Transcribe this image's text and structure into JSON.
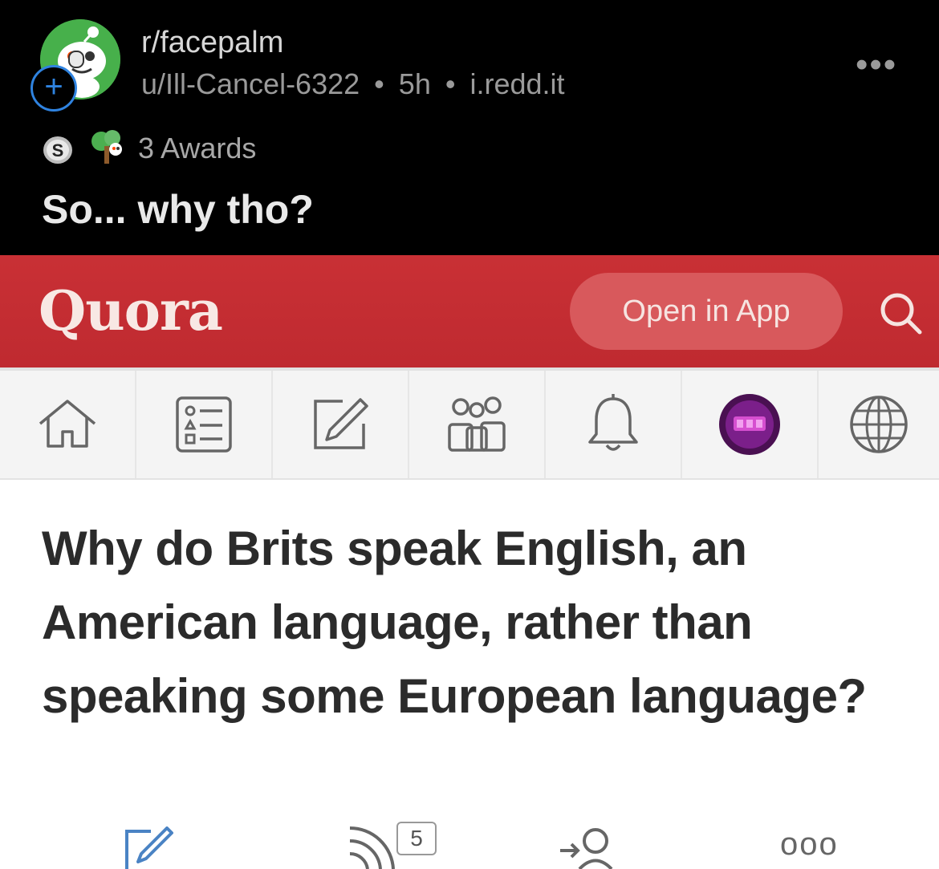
{
  "post": {
    "subreddit": "r/facepalm",
    "author": "u/Ill-Cancel-6322",
    "age": "5h",
    "domain": "i.redd.it",
    "separator": "•",
    "more": "•••",
    "join": "+",
    "awards_text": "3 Awards",
    "title": "So... why tho?"
  },
  "quora": {
    "logo": "Quora",
    "open_in_app": "Open in App",
    "nav_items": [
      "home-icon",
      "answer-list-icon",
      "write-icon",
      "spaces-icon",
      "notifications-icon",
      "profile-avatar",
      "language-globe-icon"
    ],
    "question": "Why do Brits speak English, an American language, rather than speaking some European language?",
    "action_counts": {
      "follow_count": "5"
    },
    "more_actions": "ooo"
  },
  "colors": {
    "quora_red": "#c93035",
    "reddit_blue": "#2f83e0",
    "avatar_green": "#47b04b"
  }
}
